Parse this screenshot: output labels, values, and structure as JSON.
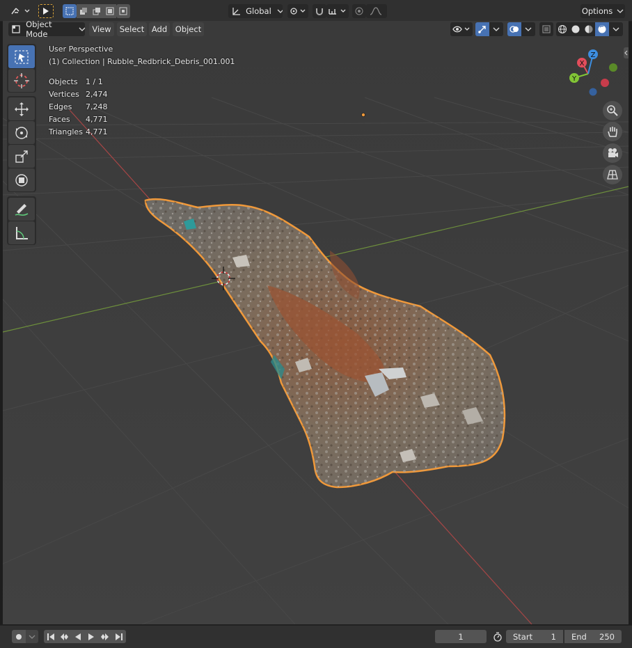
{
  "header": {
    "transform_orientation": "Global",
    "options_label": "Options"
  },
  "toolbar2": {
    "mode": "Object Mode",
    "menus": [
      "View",
      "Select",
      "Add",
      "Object"
    ]
  },
  "overlay": {
    "view_name": "User Perspective",
    "collection": "(1) Collection | Rubble_Redbrick_Debris_001.001",
    "stats": [
      {
        "label": "Objects",
        "value": "1 / 1"
      },
      {
        "label": "Vertices",
        "value": "2,474"
      },
      {
        "label": "Edges",
        "value": "7,248"
      },
      {
        "label": "Faces",
        "value": "4,771"
      },
      {
        "label": "Triangles",
        "value": "4,771"
      }
    ]
  },
  "gizmo": {
    "x": "X",
    "y": "Y",
    "z": "Z",
    "x_color": "#e34d5b",
    "y_color": "#82c436",
    "z_color": "#3d8ee0"
  },
  "timeline": {
    "current_frame": "1",
    "start_label": "Start",
    "start_value": "1",
    "end_label": "End",
    "end_value": "250"
  },
  "colors": {
    "accent": "#4772b3",
    "selection_outline": "#f0993a",
    "viewport_bg": "#3d3d3d"
  }
}
